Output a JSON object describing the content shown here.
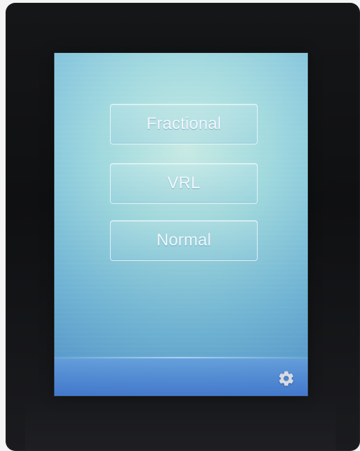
{
  "screen": {
    "buttons": [
      {
        "id": "fractional",
        "label": "Fractional"
      },
      {
        "id": "vrl",
        "label": "VRL"
      },
      {
        "id": "normal",
        "label": "Normal"
      }
    ],
    "footer": {
      "settings_icon": "gear-icon"
    }
  },
  "theme": {
    "screen_light": "#cfeff0",
    "screen_mid": "#7fbfe0",
    "screen_dark": "#4f8fd0",
    "bezel": "#111214"
  }
}
